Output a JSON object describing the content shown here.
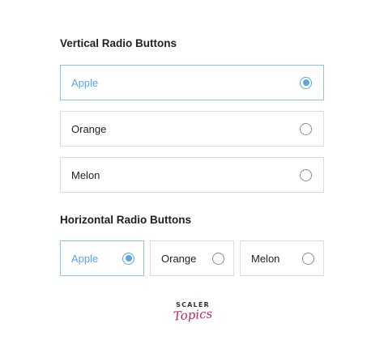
{
  "vertical": {
    "title": "Vertical Radio Buttons",
    "options": [
      {
        "label": "Apple",
        "selected": true
      },
      {
        "label": "Orange",
        "selected": false
      },
      {
        "label": "Melon",
        "selected": false
      }
    ]
  },
  "horizontal": {
    "title": "Horizontal Radio Buttons",
    "options": [
      {
        "label": "Apple",
        "selected": true
      },
      {
        "label": "Orange",
        "selected": false
      },
      {
        "label": "Melon",
        "selected": false
      }
    ]
  },
  "logo": {
    "line1": "SCALER",
    "line2": "Topics"
  },
  "colors": {
    "accent": "#5aa6e6",
    "accent_border": "#8cc3ee",
    "brand": "#c0236b"
  }
}
